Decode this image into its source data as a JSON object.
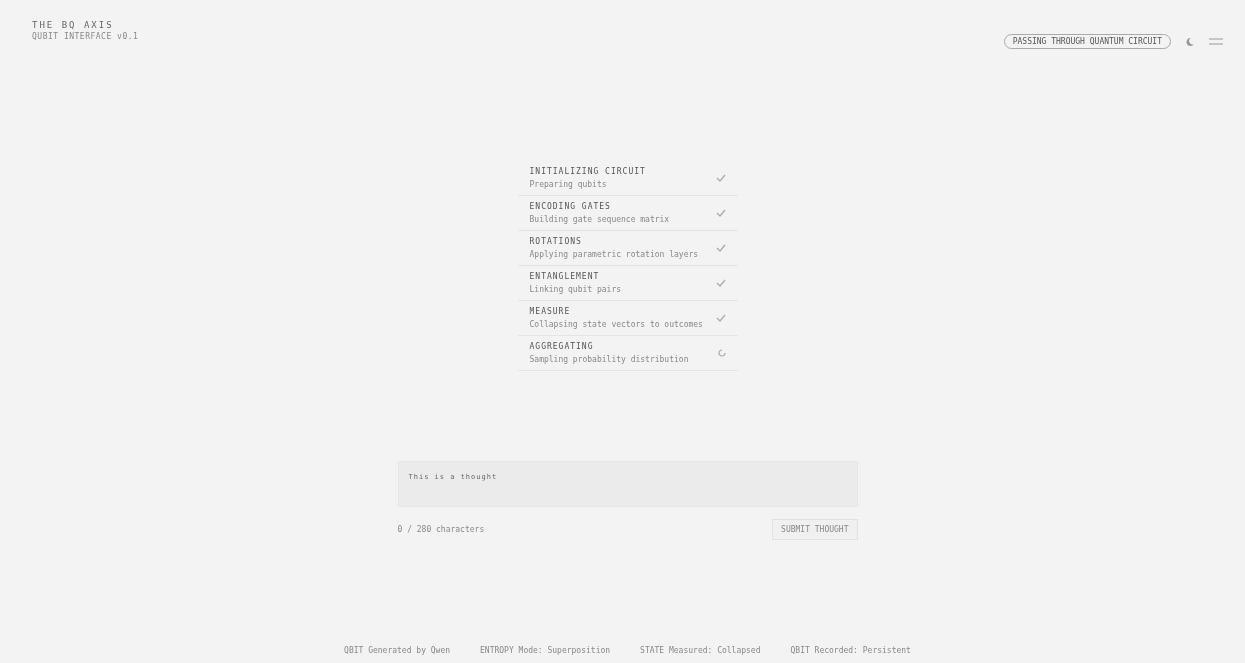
{
  "brand": {
    "title": "THE BQ AXIS",
    "subtitle": "QUBIT INTERFACE v0.1"
  },
  "header": {
    "badge": "PASSING THROUGH QUANTUM CIRCUIT"
  },
  "steps": [
    {
      "title": "INITIALIZING CIRCUIT",
      "detail": "Preparing qubits",
      "done": true
    },
    {
      "title": "ENCODING GATES",
      "detail": "Building gate sequence matrix",
      "done": true
    },
    {
      "title": "ROTATIONS",
      "detail": "Applying parametric rotation layers",
      "done": true
    },
    {
      "title": "ENTANGLEMENT",
      "detail": "Linking qubit pairs",
      "done": true
    },
    {
      "title": "MEASURE",
      "detail": "Collapsing state vectors to outcomes",
      "done": true
    },
    {
      "title": "AGGREGATING",
      "detail": "Sampling probability distribution",
      "done": false
    }
  ],
  "prompt": {
    "value": "This is a thought",
    "hint": "0 / 280 characters",
    "button": "SUBMIT THOUGHT"
  },
  "footer": [
    "QBIT Generated by Qwen",
    "ENTROPY Mode: Superposition",
    "STATE Measured: Collapsed",
    "QBIT Recorded: Persistent"
  ]
}
